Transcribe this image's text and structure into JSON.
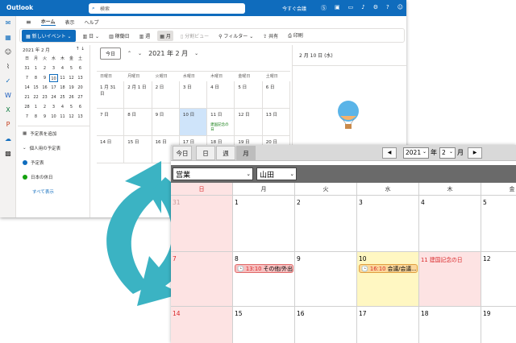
{
  "outlook": {
    "app_name": "Outlook",
    "search_placeholder": "検索",
    "meet_now": "今すぐ会議",
    "tabs": [
      "ホーム",
      "表示",
      "ヘルプ"
    ],
    "new_event": "新しいイベント",
    "ribbon": {
      "day": "日",
      "work_week": "稼働日",
      "week": "週",
      "month": "月",
      "split": "分割ビュー",
      "filter": "フィルター",
      "share": "共有",
      "print": "印刷"
    },
    "mini_calendar": {
      "title": "2021 年 2 月",
      "weekdays": [
        "日",
        "月",
        "火",
        "水",
        "木",
        "金",
        "土"
      ],
      "days": [
        "31",
        "1",
        "2",
        "3",
        "4",
        "5",
        "6",
        "7",
        "8",
        "9",
        "10",
        "11",
        "12",
        "13",
        "14",
        "15",
        "16",
        "17",
        "18",
        "19",
        "20",
        "21",
        "22",
        "23",
        "24",
        "25",
        "26",
        "27",
        "28",
        "1",
        "2",
        "3",
        "4",
        "5",
        "6",
        "7",
        "8",
        "9",
        "10",
        "11",
        "12",
        "13"
      ]
    },
    "add_calendar": "予定表を追加",
    "my_calendars": "個人用の予定表",
    "calendars": [
      {
        "name": "予定表",
        "color": "#0f6cbd"
      },
      {
        "name": "日本の休日",
        "color": "#13a10e"
      }
    ],
    "show_all": "すべて表示",
    "main": {
      "today_button": "今日",
      "month_title": "2021 年 2 月",
      "weekdays": [
        "日曜日",
        "月曜日",
        "火曜日",
        "水曜日",
        "木曜日",
        "金曜日",
        "土曜日"
      ],
      "weeks": [
        [
          "1 月 31 日",
          "2 月 1 日",
          "2 日",
          "3 日",
          "4 日",
          "5 日",
          "6 日"
        ],
        [
          "7 日",
          "8 日",
          "9 日",
          "10 日",
          "11 日",
          "12 日",
          "13 日"
        ],
        [
          "14 日",
          "15 日",
          "16 日",
          "17 日",
          "18 日",
          "19 日",
          "20 日"
        ]
      ],
      "holiday_label": "建国記念の日"
    },
    "detail_date": "2 月 10 日 (水)"
  },
  "app": {
    "views": [
      "今日",
      "日",
      "週",
      "月"
    ],
    "active_view": "月",
    "year": "2021",
    "year_suffix": "年",
    "month": "2",
    "month_suffix": "月",
    "dept": "営業",
    "user": "山田",
    "weekdays": [
      "日",
      "月",
      "火",
      "水",
      "木",
      "金"
    ],
    "week1": [
      "31",
      "1",
      "2",
      "3",
      "4",
      "5"
    ],
    "week2": [
      "7",
      "8",
      "9",
      "10",
      "11",
      "12"
    ],
    "week3": [
      "14",
      "15",
      "16",
      "17",
      "18",
      "19"
    ],
    "events": [
      {
        "time": "13:10",
        "title": "その他/外出"
      },
      {
        "time": "16:10",
        "title": "会議/会議..."
      }
    ],
    "holiday": "建国記念の日",
    "colors": {
      "sunday": "#fde3e3",
      "today": "#fff7c2",
      "holiday_text": "#d9292b",
      "arrow": "#3bb3c3"
    }
  }
}
